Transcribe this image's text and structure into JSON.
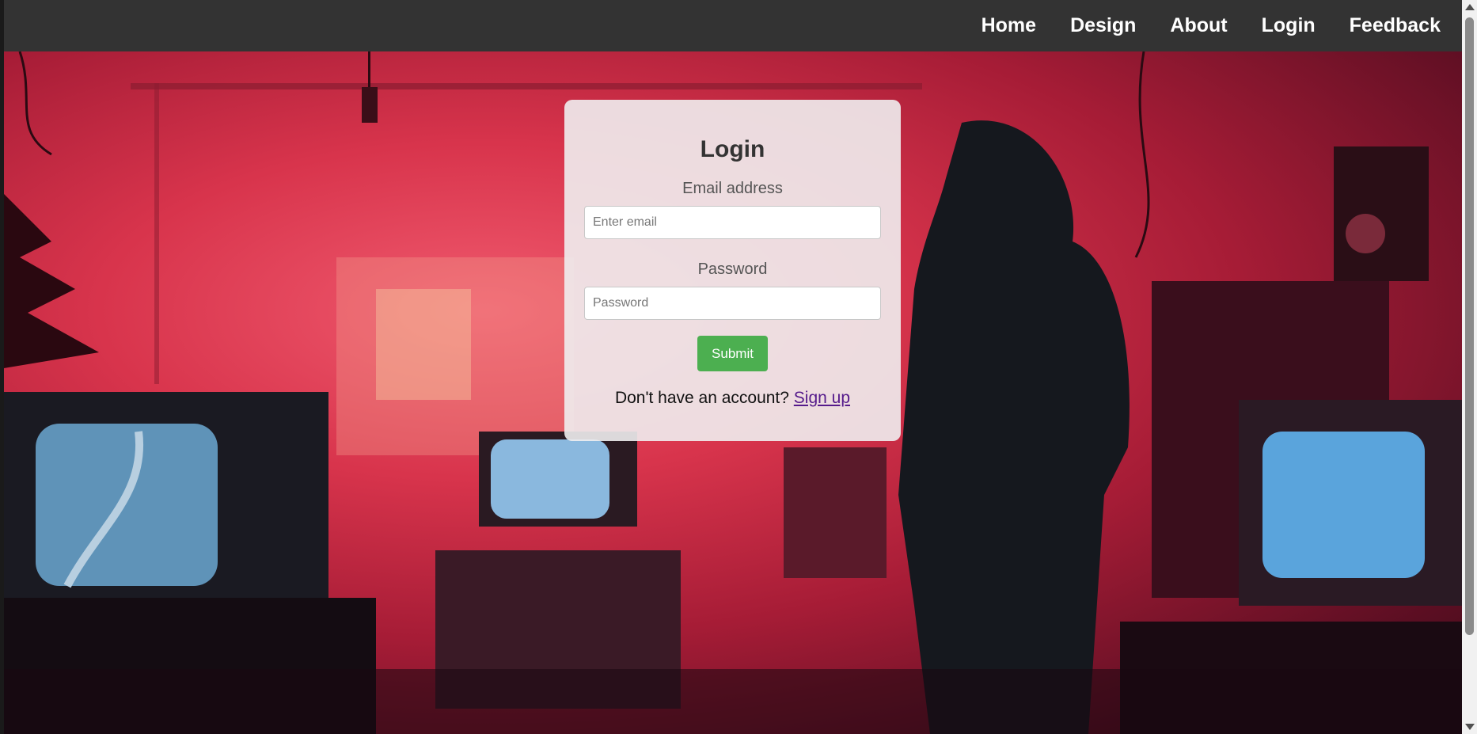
{
  "nav": {
    "items": [
      {
        "label": "Home"
      },
      {
        "label": "Design"
      },
      {
        "label": "About"
      },
      {
        "label": "Login"
      },
      {
        "label": "Feedback"
      }
    ]
  },
  "login": {
    "title": "Login",
    "email_label": "Email address",
    "email_placeholder": "Enter email",
    "password_label": "Password",
    "password_placeholder": "Password",
    "submit_label": "Submit",
    "signup_prompt": "Don't have an account?",
    "signup_link": "Sign up"
  },
  "colors": {
    "navbar": "#333333",
    "submit": "#4caf50",
    "link": "#551a8b",
    "scene_red": "#d8344c",
    "screen_blue": "#6aa6d6"
  }
}
